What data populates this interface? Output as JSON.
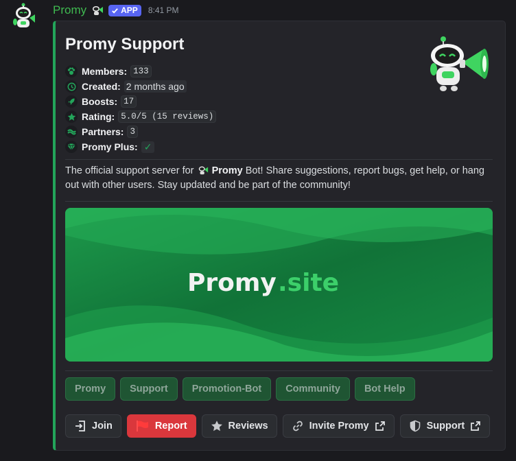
{
  "message": {
    "username": "Promy",
    "badge": "APP",
    "timestamp": "8:41 PM"
  },
  "embed": {
    "title": "Promy Support",
    "accent_color": "#23a55a",
    "fields": [
      {
        "label": "Members:",
        "value": "133",
        "icon": "paw-icon"
      },
      {
        "label": "Created:",
        "value": "2 months ago",
        "icon": "clock-icon"
      },
      {
        "label": "Boosts:",
        "value": "17",
        "icon": "rocket-icon"
      },
      {
        "label": "Rating:",
        "value": "5.0/5 (15 reviews)",
        "icon": "star-icon"
      },
      {
        "label": "Partners:",
        "value": "3",
        "icon": "handshake-icon"
      },
      {
        "label": "Promy Plus:",
        "value": "✓",
        "icon": "gem-icon"
      }
    ],
    "description": {
      "before": "The official support server for ",
      "bold": "Promy",
      "after": " Bot! Share suggestions, report bugs, get help, or hang out with other users. Stay updated and be part of the community!"
    },
    "banner": {
      "brand": "Promy",
      "suffix": ".site"
    }
  },
  "tags": [
    "Promy",
    "Support",
    "Promotion-Bot",
    "Community",
    "Bot Help"
  ],
  "actions": {
    "join": "Join",
    "report": "Report",
    "reviews": "Reviews",
    "invite": "Invite Promy",
    "support": "Support"
  },
  "colors": {
    "username": "#3fb950",
    "badge": "#5865f2",
    "danger": "#da373c",
    "tag_bg": "#1f5533"
  }
}
